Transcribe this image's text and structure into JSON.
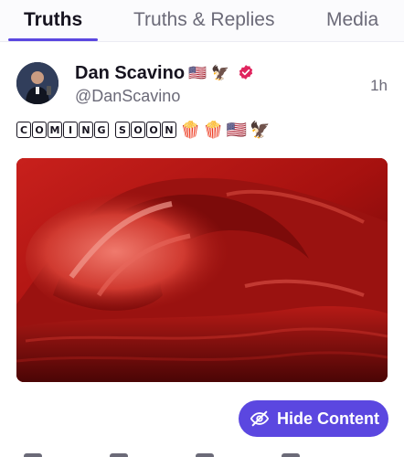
{
  "tabs": [
    {
      "label": "Truths"
    },
    {
      "label": "Truths & Replies"
    },
    {
      "label": "Media"
    }
  ],
  "post": {
    "author_name": "Dan Scavino",
    "handle": "@DanScavino",
    "time": "1h",
    "text": "🅲🅾🅼🅸🅽🅶 🆂🅾🅾🅽🍿🍿🇺🇸🦅",
    "text_words": [
      "COMING",
      "SOON"
    ],
    "text_emojis": [
      "🍿",
      "🍿",
      "🇺🇸",
      "🦅"
    ],
    "name_emojis": [
      "🇺🇸",
      "🦅"
    ]
  },
  "actions": {
    "hide_content_label": "Hide Content"
  },
  "colors": {
    "accent": "#5b47e0",
    "verified": "#e0245e",
    "text_primary": "#16131f",
    "text_secondary": "#6b6a78"
  },
  "icons": {
    "verified": "verified-badge-icon",
    "hide": "eye-slash-icon"
  }
}
